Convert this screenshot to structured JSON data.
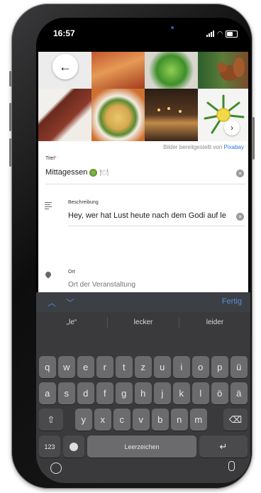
{
  "status_bar": {
    "time": "16:57"
  },
  "photos": {
    "credit_prefix": "Bilder bereitgestellt von",
    "credit_link": "Pixabay",
    "back_icon": "arrow-left-icon",
    "next_icon": "chevron-right-icon"
  },
  "form": {
    "title_label": "Titel",
    "title_required": "*",
    "title_value": "Mittagessen",
    "description_label": "Beschreibung",
    "description_value": "Hey, wer hat Lust heute nach dem Godi auf le",
    "location_label": "Ort",
    "location_placeholder": "Ort der Veranstaltung"
  },
  "keyboard": {
    "done_label": "Fertig",
    "suggestions": [
      "„le“",
      "lecker",
      "leider"
    ],
    "row1": [
      "q",
      "w",
      "e",
      "r",
      "t",
      "z",
      "u",
      "i",
      "o",
      "p",
      "ü"
    ],
    "row2": [
      "a",
      "s",
      "d",
      "f",
      "g",
      "h",
      "j",
      "k",
      "l",
      "ö",
      "ä"
    ],
    "row3": [
      "y",
      "x",
      "c",
      "v",
      "b",
      "n",
      "m"
    ],
    "numbers_label": "123",
    "space_label": "Leerzeichen"
  },
  "colors": {
    "accent": "#2a7bd5",
    "keyboard_bg": "#3a3a3c",
    "key_bg": "#6b6b6e"
  }
}
